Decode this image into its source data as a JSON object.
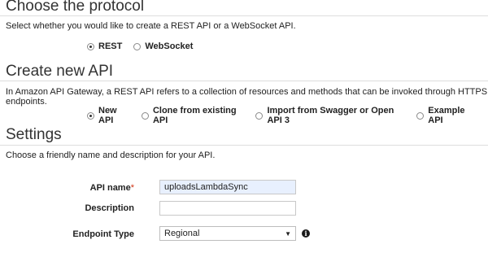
{
  "protocol": {
    "title": "Choose the protocol",
    "description": "Select whether you would like to create a REST API or a WebSocket API.",
    "options": [
      {
        "label": "REST",
        "checked": true
      },
      {
        "label": "WebSocket",
        "checked": false
      }
    ]
  },
  "create": {
    "title": "Create new API",
    "description": "In Amazon API Gateway, a REST API refers to a collection of resources and methods that can be invoked through HTTPS endpoints.",
    "options": [
      {
        "label": "New API",
        "checked": true
      },
      {
        "label": "Clone from existing API",
        "checked": false
      },
      {
        "label": "Import from Swagger or Open API 3",
        "checked": false
      },
      {
        "label": "Example API",
        "checked": false
      }
    ]
  },
  "settings": {
    "title": "Settings",
    "description": "Choose a friendly name and description for your API.",
    "api_name_label": "API name",
    "required_mark": "*",
    "api_name_value": "uploadsLambdaSync",
    "description_label": "Description",
    "description_value": "",
    "endpoint_label": "Endpoint Type",
    "endpoint_value": "Regional",
    "info_glyph": "i"
  }
}
